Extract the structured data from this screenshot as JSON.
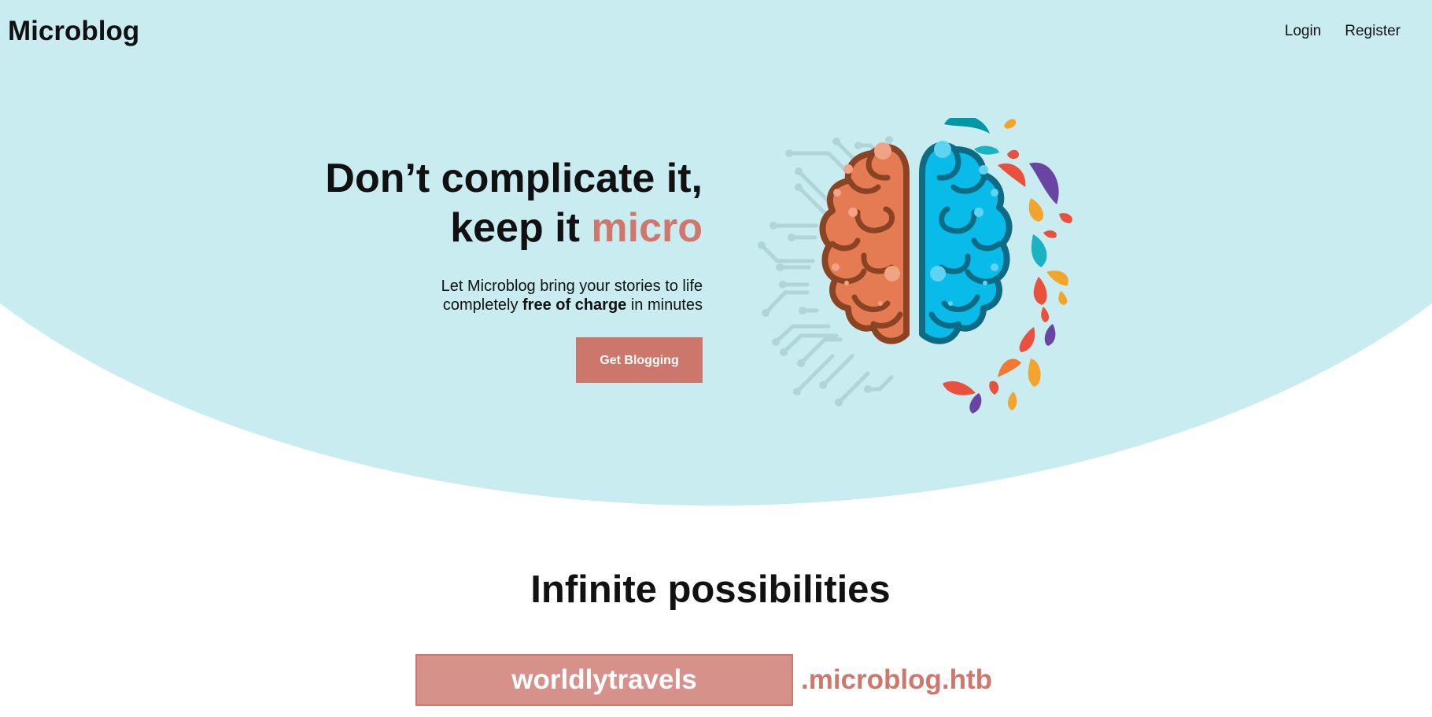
{
  "brand": {
    "name": "Microblog"
  },
  "nav": {
    "login": "Login",
    "register": "Register"
  },
  "hero": {
    "headline_line1": "Don’t complicate it,",
    "headline_line2_prefix": "keep it ",
    "headline_accent": "micro",
    "sub_line1": "Let Microblog bring your stories to life",
    "sub_line2_prefix": "completely ",
    "sub_line2_bold": "free of charge",
    "sub_line2_suffix": " in minutes",
    "cta_label": "Get Blogging"
  },
  "illustration": {
    "icon": "brain-icon"
  },
  "possibilities": {
    "title": "Infinite possibilities",
    "subdomain_value": "worldlytravels",
    "domain_suffix": ".microblog.htb"
  },
  "colors": {
    "hero_bg": "#c8ecef",
    "accent": "#cf776c",
    "button": "#cd766b",
    "input_bg": "#d6928a",
    "brain_left": "#e57b52",
    "brain_left_outline": "#8a4424",
    "brain_right": "#08bbe9",
    "brain_right_outline": "#0d6b84"
  }
}
